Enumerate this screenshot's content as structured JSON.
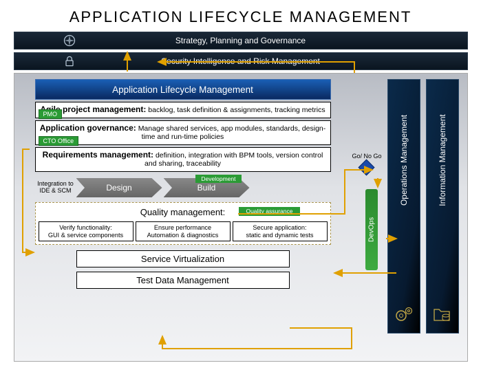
{
  "title": "APPLICATION LIFECYCLE MANAGEMENT",
  "topbars": {
    "strategy": "Strategy, Planning and Governance",
    "security": "Security Intelligence and Risk Management"
  },
  "alm": {
    "header": "Application Lifecycle Management",
    "agile": {
      "title": "Agile project management:",
      "desc": "backlog, task definition & assignments, tracking metrics",
      "tag": "PMO"
    },
    "gov": {
      "title": "Application governance:",
      "desc": "Manage shared services, app modules, standards, design-time and run-time policies",
      "tag": "CTO Office"
    },
    "req": {
      "title": "Requirements management:",
      "desc": "definition, integration with BPM tools, version control and sharing, traceability"
    },
    "design_row": {
      "int": "Integration to IDE & SCM",
      "design": "Design",
      "build": "Build",
      "dev_tag": "Development"
    },
    "qm": {
      "title": "Quality management:",
      "qa_tag": "Quality assurance",
      "cells": [
        {
          "t1": "Verify functionality:",
          "t2": "GUI & service components"
        },
        {
          "t1": "Ensure performance",
          "t2": "Automation & diagnostics"
        },
        {
          "t1": "Secure application:",
          "t2": "static and dynamic tests"
        }
      ]
    },
    "sv": "Service Virtualization",
    "tdm": "Test Data Management"
  },
  "gonogo": "Go/ No Go",
  "devops": "DevOps",
  "pillars": {
    "ops": "Operations Management",
    "info": "Information Management"
  }
}
